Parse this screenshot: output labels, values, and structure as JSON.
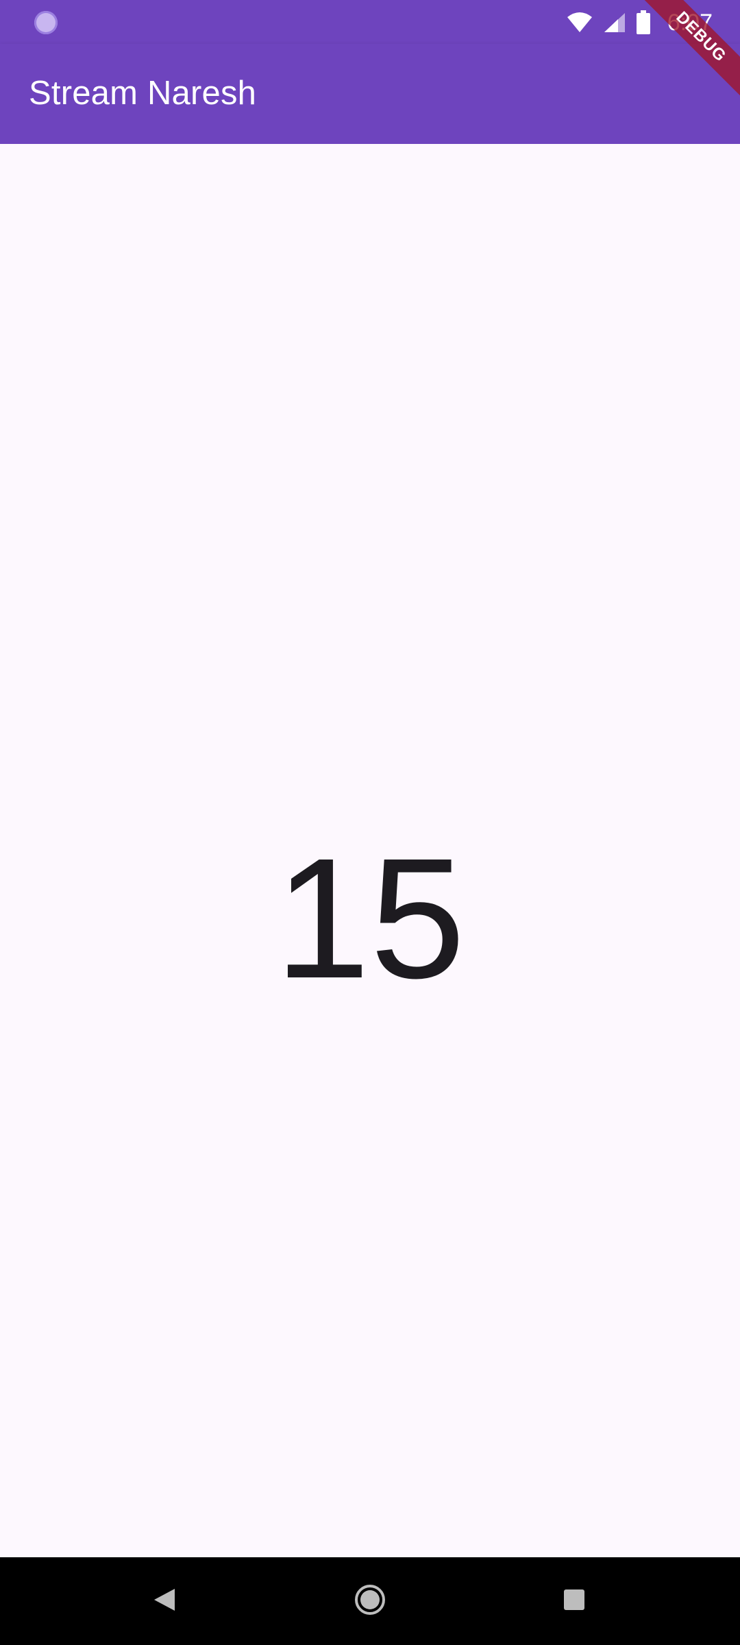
{
  "status_bar": {
    "time": "6:07",
    "icons": [
      "notification-dot-icon",
      "wifi-icon",
      "signal-icon",
      "battery-icon"
    ]
  },
  "app_bar": {
    "title": "Stream Naresh"
  },
  "debug_banner": {
    "label": "DEBUG"
  },
  "main": {
    "counter_value": "15"
  },
  "nav_bar": {
    "icons": [
      "back-icon",
      "home-icon",
      "recents-icon"
    ]
  },
  "colors": {
    "primary": "#6E44BE",
    "background": "#FDF8FE",
    "text": "#1D1B20",
    "debug": "#A01428"
  }
}
